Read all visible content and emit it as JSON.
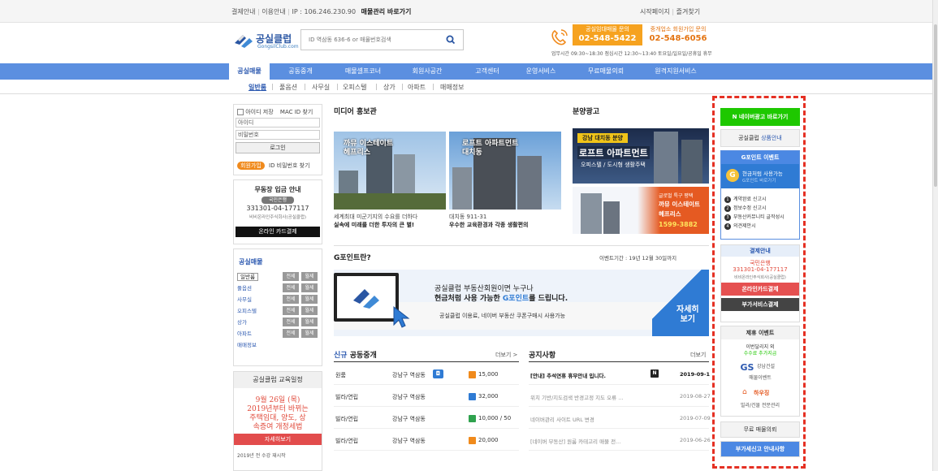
{
  "topbar": {
    "links": [
      "결제안내",
      "이용안내"
    ],
    "ip": "IP : 106.246.230.90",
    "bookmark": "매물관리 바로가기",
    "start": "시작페이지",
    "favorite": "즐겨찾기"
  },
  "logo": {
    "name": "공실클럽",
    "sub": "GongsilClub.com"
  },
  "search": {
    "placeholder": "ID 역삼동 636-6 or 매물번호검색"
  },
  "contact": [
    {
      "label": "공실임대매물 문의",
      "number": "02-548-5422"
    },
    {
      "label": "중개업소 회원가입 문의",
      "number": "02-548-6056"
    }
  ],
  "hours": "업무시간 09:30~18:30  점심시간 12:30~13:40  토요일/일요일/공휴일 휴무",
  "nav": [
    "공실매물",
    "공동중개",
    "매물셀프코너",
    "회원사공간",
    "고객센터",
    "운영서비스",
    "무료매물의뢰",
    "원격지원서비스"
  ],
  "subnav": [
    "일반룸",
    "풀옵션",
    "사무실",
    "오피스텔",
    "상가",
    "아파트",
    "매매정보"
  ],
  "login": {
    "save_id": "아이디 저장",
    "mac": "MAC ID 찾기",
    "id": "아이디",
    "pw": "비밀번호",
    "login": "로그인",
    "join": "회원가입",
    "find": "ID 비밀번호 찾기"
  },
  "bank": {
    "title": "무동장 입금 안내",
    "bank_name": "국민은행",
    "account": "331301-04-177117",
    "holder": "비비온라인주식회사(공실클럽)",
    "card": "온라인 카드결제"
  },
  "gongsil_menu": {
    "title": "공실매물",
    "items": [
      "일반룸",
      "풀옵션",
      "사무실",
      "오피스텔",
      "상가",
      "아파트",
      "매매정보"
    ],
    "jeonse": "전세",
    "wolse": "월세"
  },
  "edu": {
    "title": "공실클럽 교육일정",
    "date": "9월 26일 (목)",
    "text1": "2019년부터 바뀌는",
    "text2": "주택임대, 양도, 상",
    "text3": "속증여 개정세법",
    "more": "자세히보기",
    "footer": "2019년 전 수강 재시작"
  },
  "media": {
    "title": "미디어 홍보관",
    "items": [
      {
        "overlay": "까뮤 이스테이트\n헤프리스",
        "line1": "세계최대 미군기지의 수요를 더하다",
        "line2": "실속에 미래를 더한 투자의 큰 별!"
      },
      {
        "overlay": "로프트 아파트먼트\n대치동",
        "line1": "대치동 911-31",
        "line2": "우수한 교육환경과 각종 생활편의"
      }
    ]
  },
  "ad": {
    "title": "분양광고",
    "tag": "강남 대치동 분양",
    "headline": "로프트 아파트먼트",
    "sub": "오피스텔 / 도시형 생활주택",
    "banner2_1": "글로벌 특구 평택",
    "banner2_2": "까뮤 이스테이트",
    "banner2_3": "헤프리스",
    "banner2_phone": "1599-3882"
  },
  "gpoint": {
    "title": "G포인트란?",
    "period": "이벤트기간 : 19년 12월 30일까지",
    "line1": "공실클럽 부동산회원이면 누구나",
    "line2a": "현금처럼 사용 가능한 ",
    "line2b": "G포인트",
    "line2c": "를 드립니다.",
    "line3": "공실클럽 이용료, 네이버 부동산 쿠폰구매시 사용가능",
    "more1": "자세히",
    "more2": "보기"
  },
  "coop": {
    "title_a": "신규",
    "title_b": " 공동중개",
    "more": "더보기 >",
    "rows": [
      {
        "type": "원룸",
        "loc": "강남구 역삼동",
        "price": "15,000"
      },
      {
        "type": "빌라/연립",
        "loc": "강남구 역삼동",
        "price": "32,000"
      },
      {
        "type": "빌라/연립",
        "loc": "강남구 역삼동",
        "price": "10,000 / 50"
      },
      {
        "type": "빌라/연립",
        "loc": "강남구 역삼동",
        "price": "20,000"
      }
    ]
  },
  "notice": {
    "title": "공지사항",
    "more": "더보기",
    "rows": [
      {
        "text": "[안내] 추석연휴 휴무안내 입니다.",
        "date": "2019-09-1"
      },
      {
        "text": "위치 기반/지도검색 반경고정 지도 오류 ...",
        "date": "2019-08-27"
      },
      {
        "text": "네이버관리 사이트 URL 변경",
        "date": "2019-07-09"
      },
      {
        "text": "[네이버 부동산] 원룸 카테고리 매물 전...",
        "date": "2019-06-26"
      }
    ]
  },
  "right": {
    "naver": "N 네이버광고 바로가기",
    "product_a": "공실클럽 ",
    "product_b": "상품안내",
    "gpoint_event": "G포인트 이벤트",
    "cash": "현금처럼 사용가능",
    "cash_sub": "G포인트 바로가기",
    "list": [
      "계약완료 신고시",
      "정보수정 신고시",
      "부동산커뮤니티 글작성시",
      "의견제안시"
    ],
    "pay_title": "결제안내",
    "bank_name": "국민은행",
    "account": "331301-04-177117",
    "holder": "비비온라인주식회사(공실클럽)",
    "card": "온라인카드결제",
    "extra": "부가서비스결제",
    "partner": "제휴 이벤트",
    "partner_line1": "이번달리지 외",
    "partner_line2": "수수료 추가지급",
    "gs_name": "강남건설",
    "gs_sub": "매물이벤트",
    "ha_name": "하우징",
    "ha_sub": "빌라/건물 전문관리",
    "free": "무료 매물의뢰",
    "vat": "부가세신고 안내사항"
  }
}
